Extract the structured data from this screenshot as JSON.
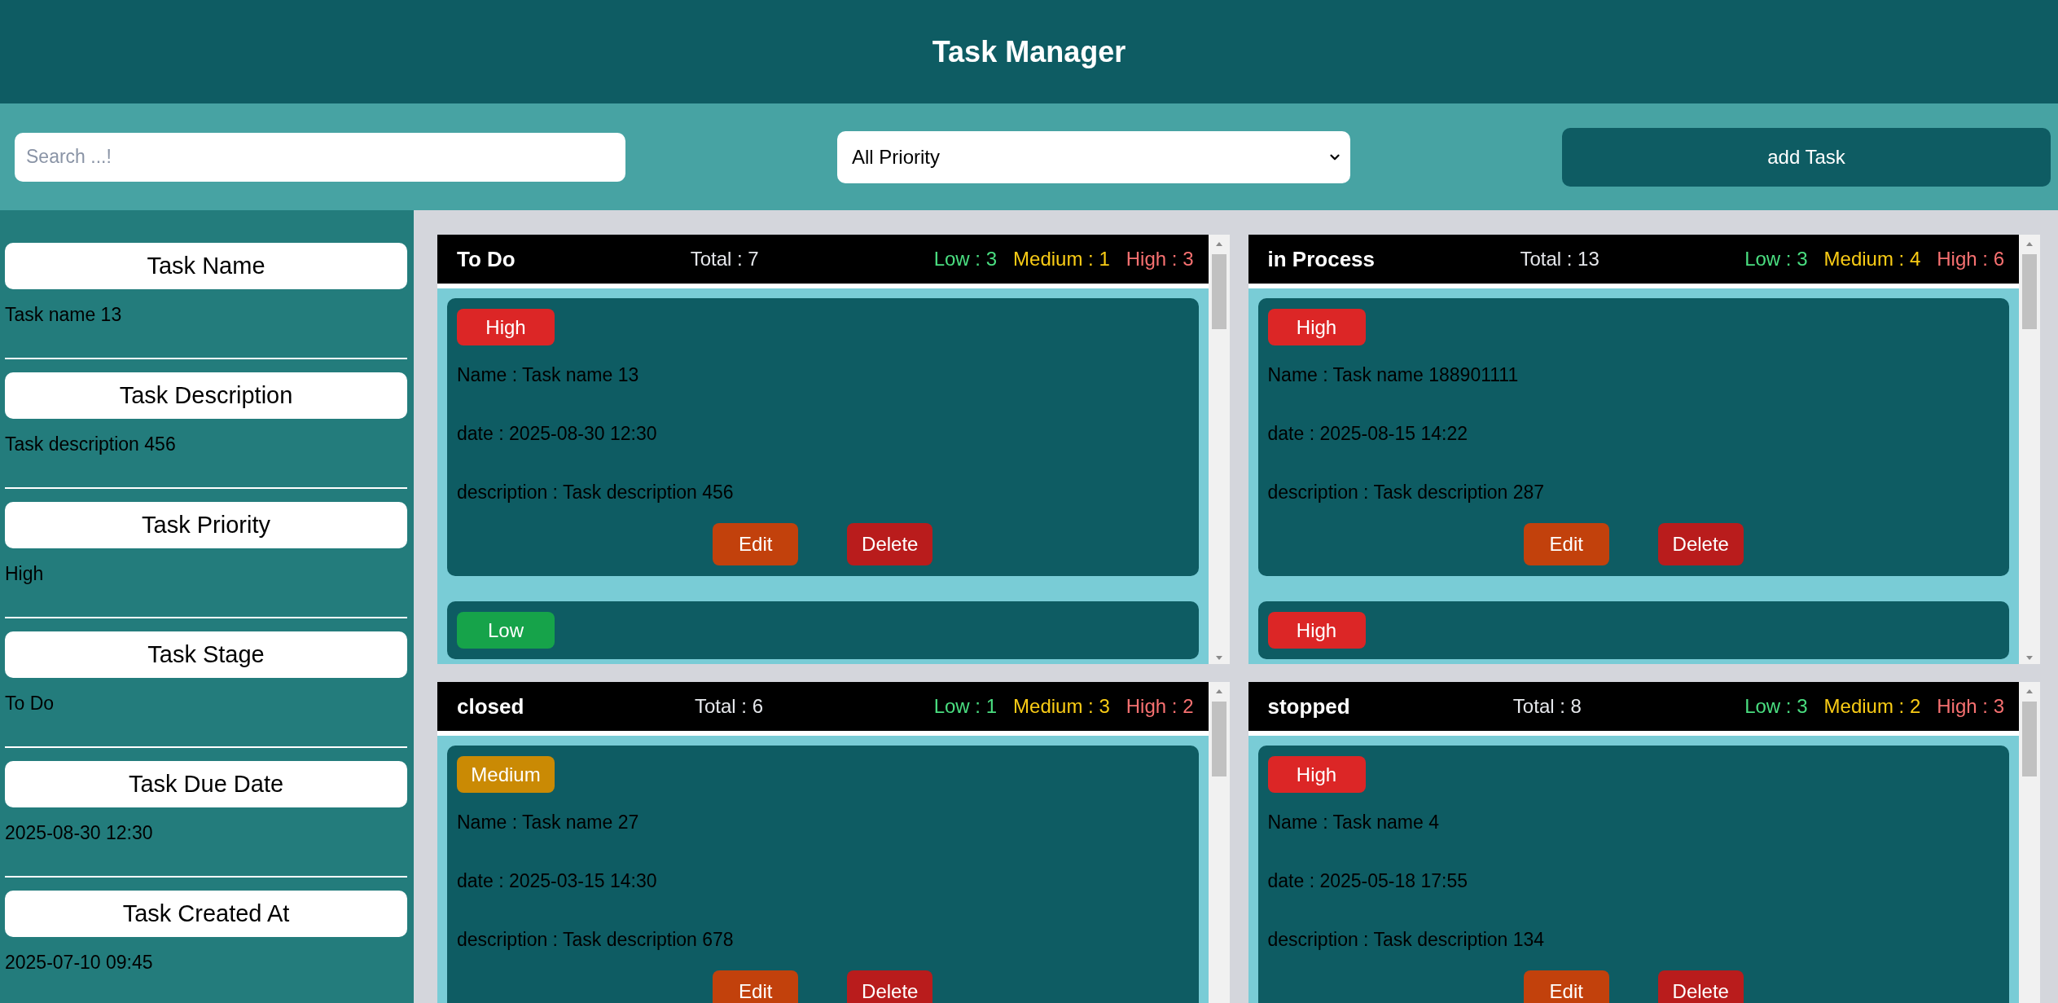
{
  "header": {
    "title": "Task Manager"
  },
  "toolbar": {
    "search": {
      "placeholder": "Search ...!"
    },
    "priority_filter": {
      "value": "All Priority"
    },
    "add_button": "add Task"
  },
  "details": [
    {
      "label": "Task Name",
      "value": "Task name 13"
    },
    {
      "label": "Task Description",
      "value": "Task description 456"
    },
    {
      "label": "Task Priority",
      "value": "High"
    },
    {
      "label": "Task Stage",
      "value": "To Do"
    },
    {
      "label": "Task Due Date",
      "value": "2025-08-30 12:30"
    },
    {
      "label": "Task Created At",
      "value": "2025-07-10 09:45"
    }
  ],
  "boards": [
    {
      "title": "To Do",
      "total": "Total : 7",
      "counts": [
        {
          "kind": "low",
          "text": "Low : 3"
        },
        {
          "kind": "medium",
          "text": "Medium : 1"
        },
        {
          "kind": "high",
          "text": "High : 3"
        }
      ],
      "cards": [
        {
          "priority": {
            "kind": "high",
            "text": "High"
          },
          "lines": [
            "Name : Task name 13",
            "date : 2025-08-30 12:30",
            "description : Task description 456"
          ],
          "actions": [
            {
              "kind": "edit",
              "text": "Edit"
            },
            {
              "kind": "delete",
              "text": "Delete"
            }
          ]
        },
        {
          "priority": {
            "kind": "low",
            "text": "Low"
          }
        }
      ]
    },
    {
      "title": "in Process",
      "total": "Total : 13",
      "counts": [
        {
          "kind": "low",
          "text": "Low : 3"
        },
        {
          "kind": "medium",
          "text": "Medium : 4"
        },
        {
          "kind": "high",
          "text": "High : 6"
        }
      ],
      "cards": [
        {
          "priority": {
            "kind": "high",
            "text": "High"
          },
          "lines": [
            "Name : Task name 188901111",
            "date : 2025-08-15 14:22",
            "description : Task description 287"
          ],
          "actions": [
            {
              "kind": "edit",
              "text": "Edit"
            },
            {
              "kind": "delete",
              "text": "Delete"
            }
          ]
        },
        {
          "priority": {
            "kind": "high",
            "text": "High"
          }
        }
      ]
    },
    {
      "title": "closed",
      "total": "Total : 6",
      "counts": [
        {
          "kind": "low",
          "text": "Low : 1"
        },
        {
          "kind": "medium",
          "text": "Medium : 3"
        },
        {
          "kind": "high",
          "text": "High : 2"
        }
      ],
      "cards": [
        {
          "priority": {
            "kind": "medium",
            "text": "Medium"
          },
          "lines": [
            "Name : Task name 27",
            "date : 2025-03-15 14:30",
            "description : Task description 678"
          ],
          "actions": [
            {
              "kind": "edit",
              "text": "Edit"
            },
            {
              "kind": "delete",
              "text": "Delete"
            }
          ]
        }
      ]
    },
    {
      "title": "stopped",
      "total": "Total : 8",
      "counts": [
        {
          "kind": "low",
          "text": "Low : 3"
        },
        {
          "kind": "medium",
          "text": "Medium : 2"
        },
        {
          "kind": "high",
          "text": "High : 3"
        }
      ],
      "cards": [
        {
          "priority": {
            "kind": "high",
            "text": "High"
          },
          "lines": [
            "Name : Task name 4",
            "date : 2025-05-18 17:55",
            "description : Task description 134"
          ],
          "actions": [
            {
              "kind": "edit",
              "text": "Edit"
            },
            {
              "kind": "delete",
              "text": "Delete"
            }
          ]
        }
      ]
    }
  ]
}
